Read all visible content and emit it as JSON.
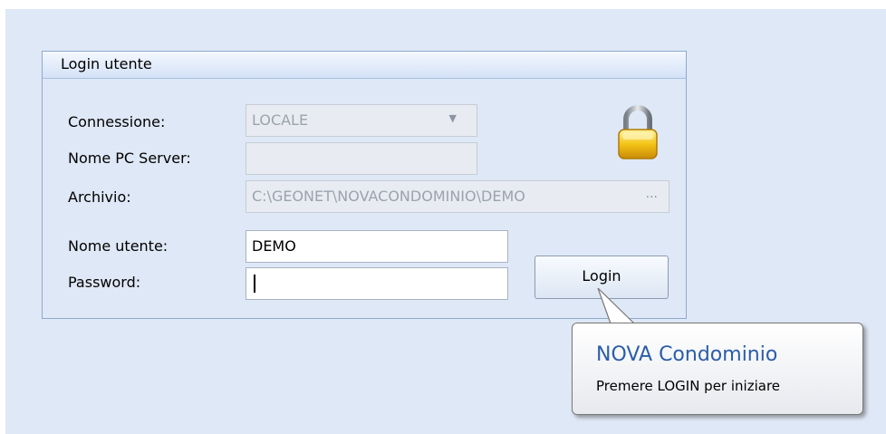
{
  "login_panel": {
    "title": "Login utente",
    "connessione_label": "Connessione:",
    "connessione_value": "LOCALE",
    "nome_pc_label": "Nome PC Server:",
    "nome_pc_value": "",
    "archivio_label": "Archivio:",
    "archivio_value": "C:\\GEONET\\NOVACONDOMINIO\\DEMO",
    "archivio_button": "...",
    "username_label": "Nome utente:",
    "username_value": "DEMO",
    "password_label": "Password:",
    "password_value": "",
    "login_button": "Login",
    "lock_icon": "padlock-icon"
  },
  "tooltip": {
    "title": "NOVA Condominio",
    "text": "Premere LOGIN per iniziare"
  },
  "colors": {
    "background": "#dfe8f6",
    "panel_border": "#8ea9d0",
    "tooltip_title": "#2b5da8"
  }
}
